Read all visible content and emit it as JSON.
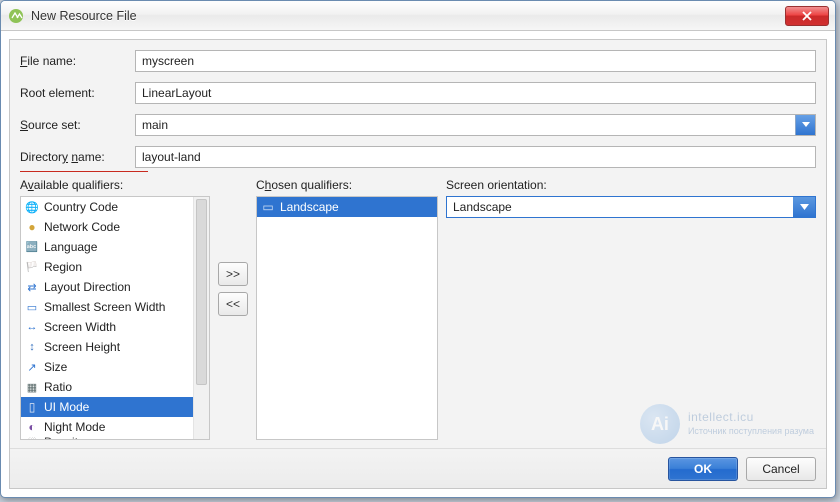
{
  "window": {
    "title": "New Resource File"
  },
  "fields": {
    "file_name": {
      "label": "File name:",
      "underline": "F",
      "value": "myscreen"
    },
    "root_element": {
      "label": "Root element:",
      "value": "LinearLayout"
    },
    "source_set": {
      "label": "Source set:",
      "underline": "S",
      "value": "main"
    },
    "directory_name": {
      "label": "Directory name:",
      "underline1": "y",
      "underline2": "n",
      "value": "layout-land"
    }
  },
  "available": {
    "label": "Available qualifiers:",
    "items": [
      {
        "icon": "globe",
        "label": "Country Code"
      },
      {
        "icon": "net",
        "label": "Network Code"
      },
      {
        "icon": "lang",
        "label": "Language"
      },
      {
        "icon": "region",
        "label": "Region"
      },
      {
        "icon": "ldir",
        "label": "Layout Direction"
      },
      {
        "icon": "sw",
        "label": "Smallest Screen Width"
      },
      {
        "icon": "wid",
        "label": "Screen Width"
      },
      {
        "icon": "hei",
        "label": "Screen Height"
      },
      {
        "icon": "size",
        "label": "Size"
      },
      {
        "icon": "ratio",
        "label": "Ratio"
      },
      {
        "icon": "uimode",
        "label": "UI Mode",
        "selected": true
      },
      {
        "icon": "night",
        "label": "Night Mode"
      },
      {
        "icon": "density",
        "label": "Density",
        "cut": true
      }
    ]
  },
  "transfer": {
    "add": ">>",
    "remove": "<<"
  },
  "chosen": {
    "label": "Chosen qualifiers:",
    "items": [
      {
        "icon": "landscape",
        "label": "Landscape",
        "selected": true
      }
    ]
  },
  "config": {
    "label": "Screen orientation:",
    "value": "Landscape"
  },
  "buttons": {
    "ok": "OK",
    "cancel": "Cancel"
  },
  "watermark": {
    "logo": "Ai",
    "line1": "intellect.icu",
    "line2": "Источник поступления разума"
  }
}
